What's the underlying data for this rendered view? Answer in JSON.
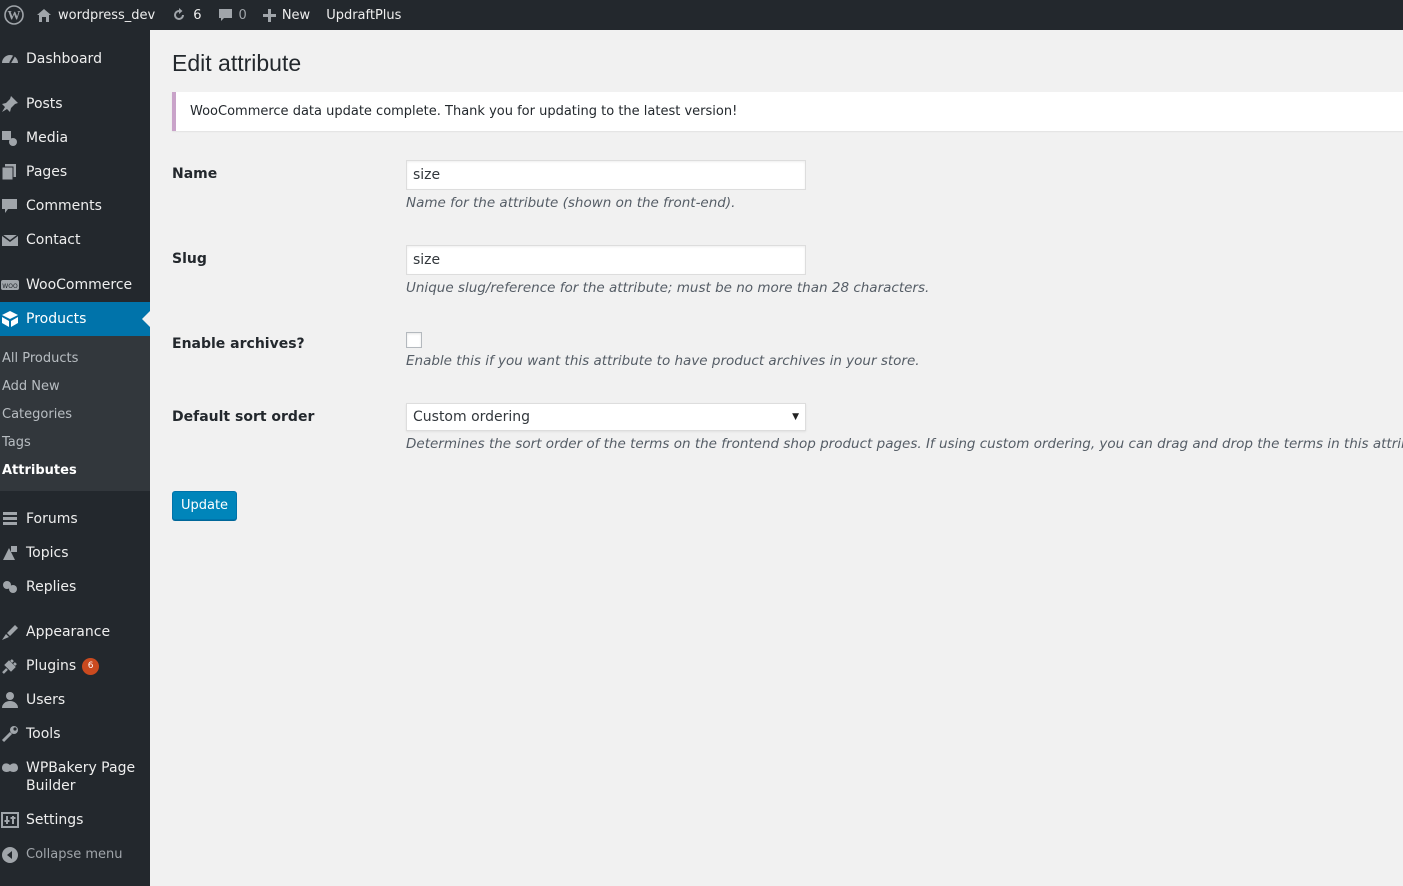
{
  "adminbar": {
    "site_name": "wordpress_dev",
    "updates_count": "6",
    "comments_count": "0",
    "new_label": "New",
    "updraft_label": "UpdraftPlus"
  },
  "sidebar": {
    "items": [
      {
        "label": "Dashboard",
        "icon": "dashboard-icon"
      },
      {
        "label": "Posts",
        "icon": "pin-icon"
      },
      {
        "label": "Media",
        "icon": "media-icon"
      },
      {
        "label": "Pages",
        "icon": "pages-icon"
      },
      {
        "label": "Comments",
        "icon": "comments-icon"
      },
      {
        "label": "Contact",
        "icon": "mail-icon"
      },
      {
        "label": "WooCommerce",
        "icon": "woo-icon"
      },
      {
        "label": "Products",
        "icon": "products-icon"
      },
      {
        "label": "Forums",
        "icon": "forums-icon"
      },
      {
        "label": "Topics",
        "icon": "topics-icon"
      },
      {
        "label": "Replies",
        "icon": "replies-icon"
      },
      {
        "label": "Appearance",
        "icon": "appearance-icon"
      },
      {
        "label": "Plugins",
        "icon": "plugins-icon",
        "badge": "6"
      },
      {
        "label": "Users",
        "icon": "users-icon"
      },
      {
        "label": "Tools",
        "icon": "tools-icon"
      },
      {
        "label": "WPBakery Page",
        "label2": "Builder",
        "icon": "wpbakery-icon"
      },
      {
        "label": "Settings",
        "icon": "settings-icon"
      },
      {
        "label": "Collapse menu",
        "icon": "collapse-icon"
      }
    ],
    "submenu": [
      "All Products",
      "Add New",
      "Categories",
      "Tags",
      "Attributes"
    ]
  },
  "main": {
    "title": "Edit attribute",
    "notice": "WooCommerce data update complete. Thank you for updating to the latest version!",
    "name_label": "Name",
    "name_value": "size",
    "name_desc": "Name for the attribute (shown on the front-end).",
    "slug_label": "Slug",
    "slug_value": "size",
    "slug_desc": "Unique slug/reference for the attribute; must be no more than 28 characters.",
    "archives_label": "Enable archives?",
    "archives_checked": false,
    "archives_desc": "Enable this if you want this attribute to have product archives in your store.",
    "sort_label": "Default sort order",
    "sort_value": "Custom ordering",
    "sort_desc": "Determines the sort order of the terms on the frontend shop product pages. If using custom ordering, you can drag and drop the terms in this attribute.",
    "update_button": "Update"
  },
  "colors": {
    "adminbar_bg": "#23282d",
    "sidebar_bg": "#23282d",
    "submenu_bg": "#32373c",
    "current_menu": "#0073aa",
    "primary_button": "#0085ba",
    "badge": "#ca4a1f",
    "notice_border": "#c9a3c9"
  }
}
